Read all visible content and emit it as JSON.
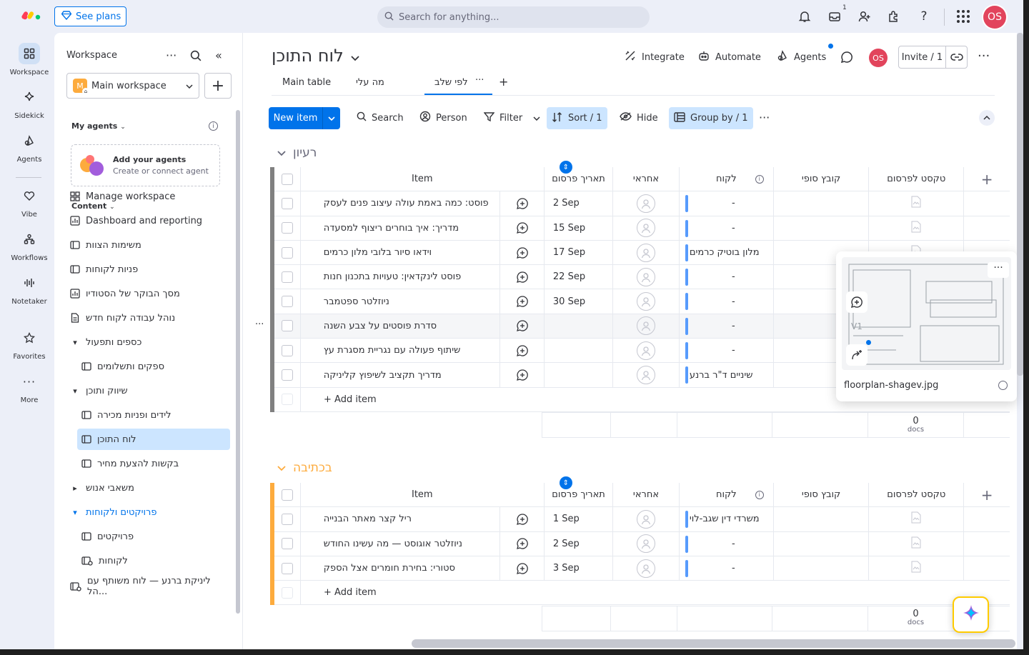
{
  "topbar": {
    "see_plans": "See plans",
    "search_placeholder": "Search for anything...",
    "inbox_badge": "1",
    "avatar": "OS"
  },
  "rail": [
    {
      "label": "Workspace",
      "icon": "grid-icon",
      "active": true
    },
    {
      "label": "Sidekick",
      "icon": "sparkle-icon"
    },
    {
      "label": "Agents",
      "icon": "agents-icon"
    },
    {
      "label": "Vibe",
      "icon": "heart-icon"
    },
    {
      "label": "Workflows",
      "icon": "workflows-icon"
    },
    {
      "label": "Notetaker",
      "icon": "soundwave-icon"
    },
    {
      "label": "Favorites",
      "icon": "star-icon"
    },
    {
      "label": "More",
      "icon": "more-icon"
    }
  ],
  "sidebar": {
    "title": "Workspace",
    "workspace_name": "Main workspace",
    "workspace_letter": "M",
    "my_agents": "My agents",
    "agent_card_title": "Add your agents",
    "agent_card_sub": "Create or connect agent",
    "content": "Content",
    "items": [
      {
        "label": "Manage workspace",
        "icon": "manage-icon"
      },
      {
        "label": "Dashboard and reporting",
        "icon": "dashboard-icon"
      },
      {
        "label": "משימות הצוות",
        "icon": "board-icon"
      },
      {
        "label": "פניות לקוחות",
        "icon": "board-icon"
      },
      {
        "label": "מסך הבוקר של הסטודיו",
        "icon": "dashboard-icon"
      },
      {
        "label": "נוהל עבודה לקוח חדש",
        "icon": "doc-icon"
      },
      {
        "label": "כספים ותפעול",
        "icon": "folder",
        "arrow": "▾"
      },
      {
        "label": "ספקים ותשלומים",
        "icon": "board-icon"
      },
      {
        "label": "שיווק ותוכן",
        "icon": "folder",
        "arrow": "▾"
      },
      {
        "label": "לידים ופניות מכירה",
        "icon": "board-icon"
      },
      {
        "label": "לוח התוכן",
        "icon": "board-icon",
        "active": true
      },
      {
        "label": "בקשות להצעת מחיר",
        "icon": "board-icon"
      },
      {
        "label": "משאבי אנוש",
        "icon": "folder",
        "arrow": "▸"
      },
      {
        "label": "פרויקטים ולקוחות",
        "icon": "folder",
        "arrow": "▾",
        "blue": true
      },
      {
        "label": "פרויקטים",
        "icon": "board-icon"
      },
      {
        "label": "לקוחות",
        "icon": "shared-board-icon"
      },
      {
        "label": "ליניקת ברנע — לוח משותף עם הל...",
        "icon": "shared-board-icon"
      }
    ]
  },
  "board": {
    "title": "לוח התוכן",
    "integrate": "Integrate",
    "automate": "Automate",
    "agents": "Agents",
    "avatar": "OS",
    "invite": "Invite / 1",
    "tabs": [
      "Main table",
      "מה עלי",
      "לפי שלב"
    ],
    "toolbar": {
      "new_item": "New item",
      "search": "Search",
      "person": "Person",
      "filter": "Filter",
      "sort": "Sort / 1",
      "hide": "Hide",
      "group_by": "Group by / 1"
    },
    "columns": {
      "item": "Item",
      "date": "תאריך פרסום",
      "owner": "אחראי",
      "client": "לקוח",
      "file": "קובץ סופי",
      "text": "טקסט לפרסום"
    },
    "add_item": "+ Add item",
    "groups": [
      {
        "title": "רעיון",
        "color": "#808080",
        "rows": [
          {
            "item": "פוסט: כמה באמת עולה עיצוב פנים לעסק",
            "date": "2 Sep",
            "client": "-"
          },
          {
            "item": "מדריך: איך בוחרים ריצוף למסעדה",
            "date": "15 Sep",
            "client": "-"
          },
          {
            "item": "וידאו סיור בלובי מלון כרמים",
            "date": "17 Sep",
            "client": "מלון בוטיק כרמים"
          },
          {
            "item": "פוסט לינקדאין: טעויות בתכנון חנות",
            "date": "22 Sep",
            "client": "-"
          },
          {
            "item": "ניוזלטר ספטמבר",
            "date": "30 Sep",
            "client": "-"
          },
          {
            "item": "סדרת פוסטים על צבע השנה",
            "date": "",
            "client": "-"
          },
          {
            "item": "שיתוף פעולה עם נגריית מסגרת עץ",
            "date": "",
            "client": "-"
          },
          {
            "item": "מדריך תקציב לשיפוץ קליניקה",
            "date": "",
            "client": "שיניים ד\"ר ברנע"
          }
        ],
        "summary_count": "0",
        "summary_unit": "docs"
      },
      {
        "title": "בכתיבה",
        "color": "#fdab3d",
        "rows": [
          {
            "item": "ריל קצר מאתר הבנייה",
            "date": "1 Sep",
            "client": "משרדי דין שגב-לוי"
          },
          {
            "item": "ניוזלטר אוגוסט — מה עשינו החודש",
            "date": "2 Sep",
            "client": "-"
          },
          {
            "item": "סטורי: בחירת חומרים אצל הספק",
            "date": "3 Sep",
            "client": "-"
          }
        ],
        "summary_count": "0",
        "summary_unit": "docs"
      }
    ],
    "preview": {
      "filename": "floorplan-shagev.jpg",
      "version": "V1"
    }
  }
}
